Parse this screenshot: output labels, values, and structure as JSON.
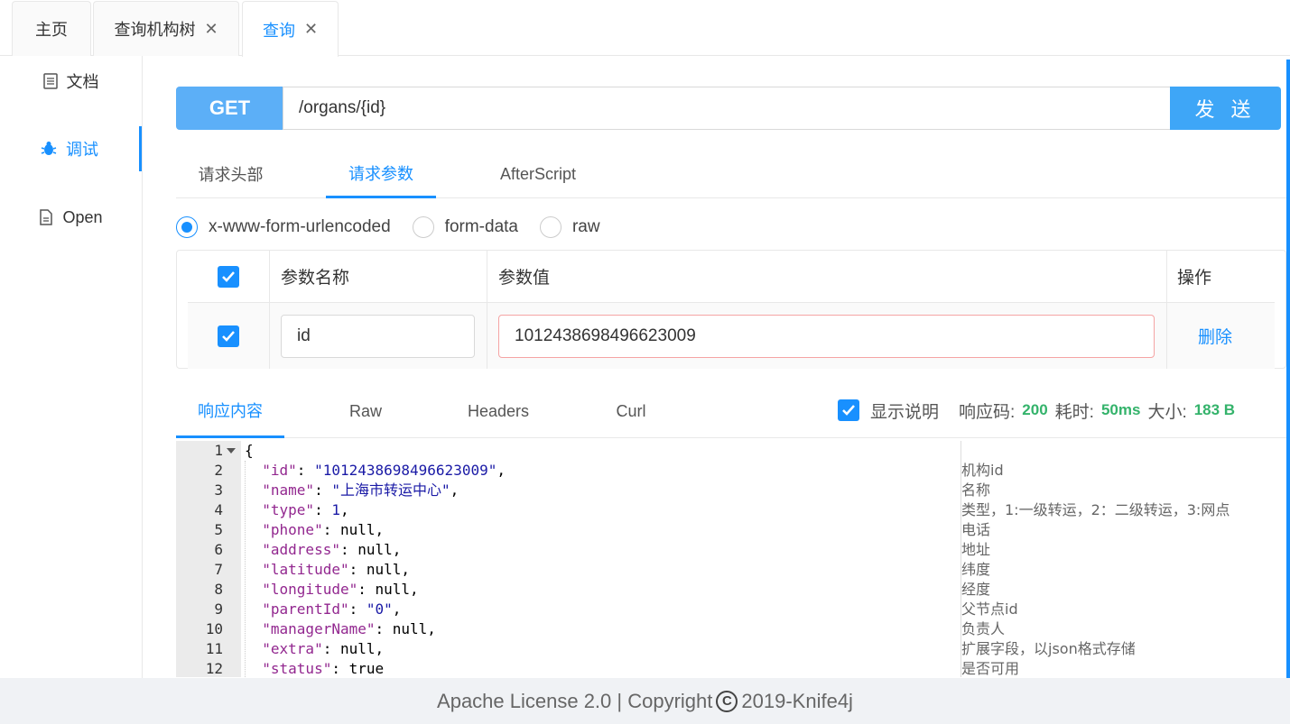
{
  "tabs": [
    {
      "label": "主页",
      "close": ""
    },
    {
      "label": "查询机构树",
      "close": "✕"
    },
    {
      "label": "查询",
      "close": "✕"
    }
  ],
  "left_menu": {
    "doc": "文档",
    "debug": "调试",
    "open": "Open"
  },
  "request": {
    "method": "GET",
    "url": "/organs/{id}",
    "send_label": "发 送"
  },
  "sub_tabs": [
    "请求头部",
    "请求参数",
    "AfterScript"
  ],
  "body_types": [
    "x-www-form-urlencoded",
    "form-data",
    "raw"
  ],
  "params_table": {
    "headers": [
      "参数名称",
      "参数值",
      "操作"
    ],
    "rows": [
      {
        "name": "id",
        "value": "1012438698496623009",
        "action": "删除"
      }
    ]
  },
  "response_tabs": [
    "响应内容",
    "Raw",
    "Headers",
    "Curl"
  ],
  "response_info": {
    "show_desc_label": "显示说明",
    "code_label": "响应码:",
    "code": "200",
    "time_label": "耗时:",
    "time": "50ms",
    "size_label": "大小:",
    "size": "183 B"
  },
  "code_lines": [
    {
      "n": "1",
      "text": "{",
      "desc": ""
    },
    {
      "n": "2",
      "key": "\"id\"",
      "val": "\"1012438698496623009\"",
      "tail": ",",
      "desc": "机构id"
    },
    {
      "n": "3",
      "key": "\"name\"",
      "val": "\"上海市转运中心\"",
      "tail": ",",
      "desc": "名称"
    },
    {
      "n": "4",
      "key": "\"type\"",
      "val": "1",
      "tail": ",",
      "desc": "类型，1:一级转运，2：二级转运，3:网点"
    },
    {
      "n": "5",
      "key": "\"phone\"",
      "val": "null",
      "tail": ",",
      "desc": "电话"
    },
    {
      "n": "6",
      "key": "\"address\"",
      "val": "null",
      "tail": ",",
      "desc": "地址"
    },
    {
      "n": "7",
      "key": "\"latitude\"",
      "val": "null",
      "tail": ",",
      "desc": "纬度"
    },
    {
      "n": "8",
      "key": "\"longitude\"",
      "val": "null",
      "tail": ",",
      "desc": "经度"
    },
    {
      "n": "9",
      "key": "\"parentId\"",
      "val": "\"0\"",
      "tail": ",",
      "desc": "父节点id"
    },
    {
      "n": "10",
      "key": "\"managerName\"",
      "val": "null",
      "tail": ",",
      "desc": "负责人"
    },
    {
      "n": "11",
      "key": "\"extra\"",
      "val": "null",
      "tail": ",",
      "desc": "扩展字段，以json格式存储"
    },
    {
      "n": "12",
      "key": "\"status\"",
      "val": "true",
      "tail": "",
      "desc": "是否可用"
    }
  ],
  "footer": {
    "left": "Apache License 2.0 | Copyright",
    "symbol": "C",
    "right": "2019-",
    "brand": "Knife4j"
  }
}
